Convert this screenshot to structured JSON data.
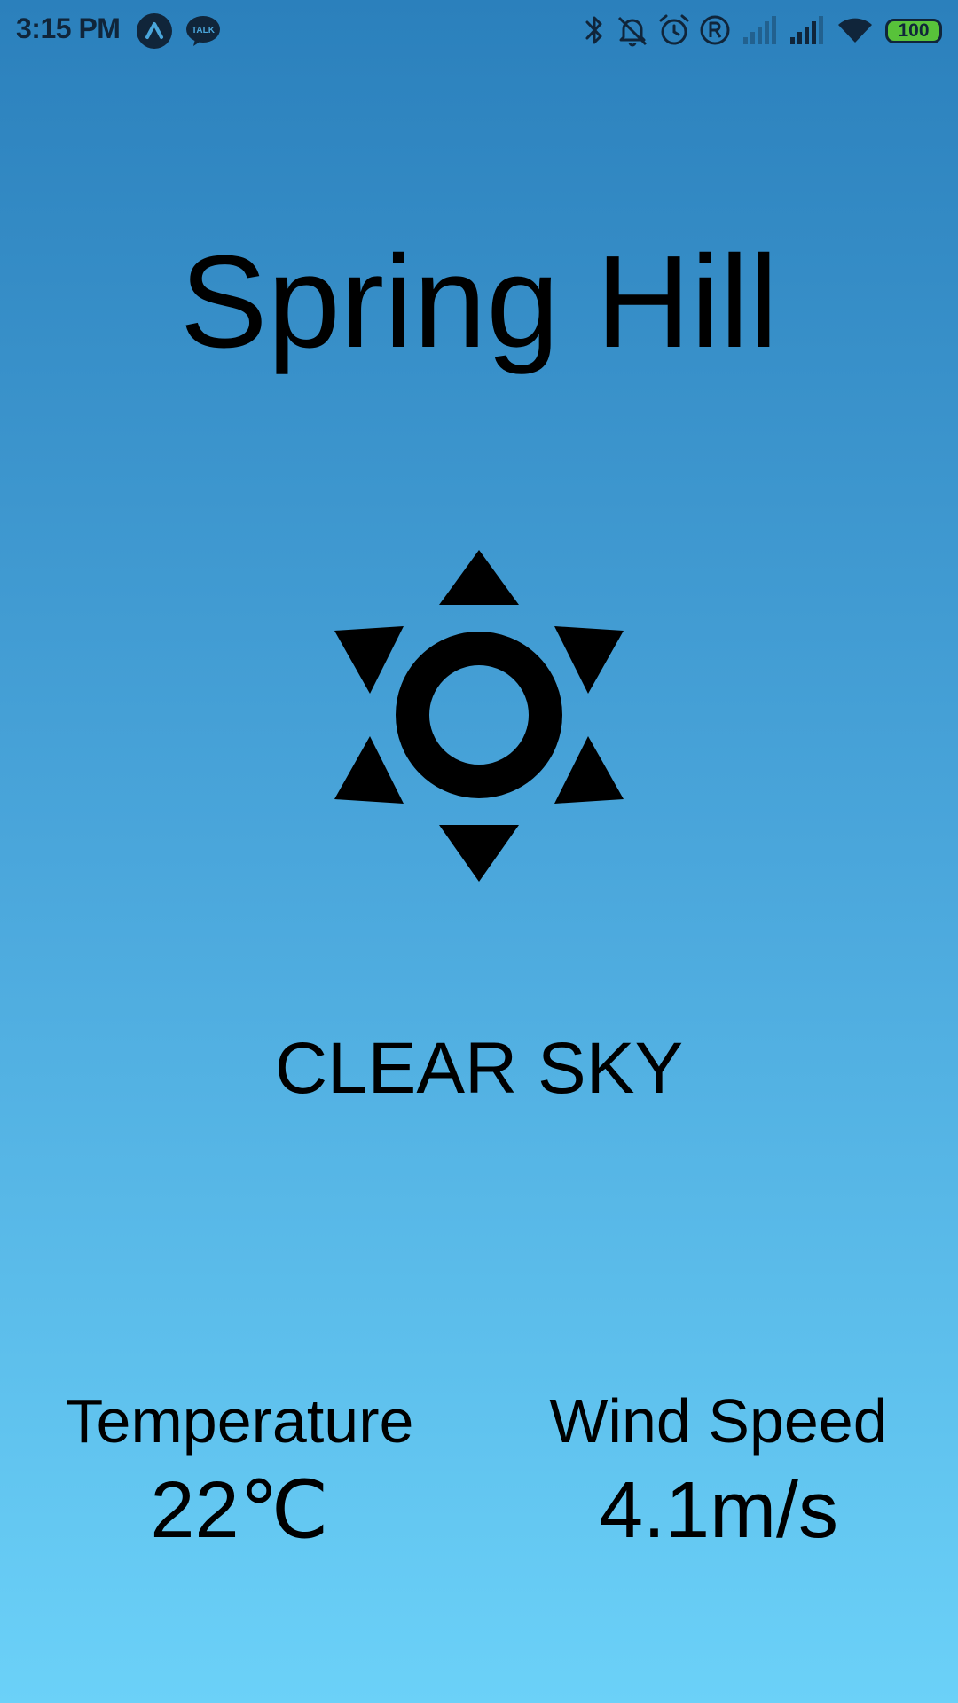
{
  "status_bar": {
    "time": "3:15 PM",
    "battery_level": "100",
    "icons": [
      "notification-a-icon",
      "kakaotalk-icon",
      "bluetooth-icon",
      "mute-icon",
      "alarm-icon",
      "registered-icon",
      "signal-icon",
      "signal-icon",
      "wifi-icon",
      "battery-icon"
    ]
  },
  "weather": {
    "city": "Spring Hill",
    "icon": "sun-icon",
    "description": "CLEAR SKY",
    "temperature_label": "Temperature",
    "temperature_value": "22℃",
    "wind_label": "Wind Speed",
    "wind_value": "4.1m/s"
  },
  "colors": {
    "gradient_top": "#2b80bc",
    "gradient_bottom": "#6bd1f8",
    "text": "#000000",
    "battery_fill": "#58c23a"
  }
}
